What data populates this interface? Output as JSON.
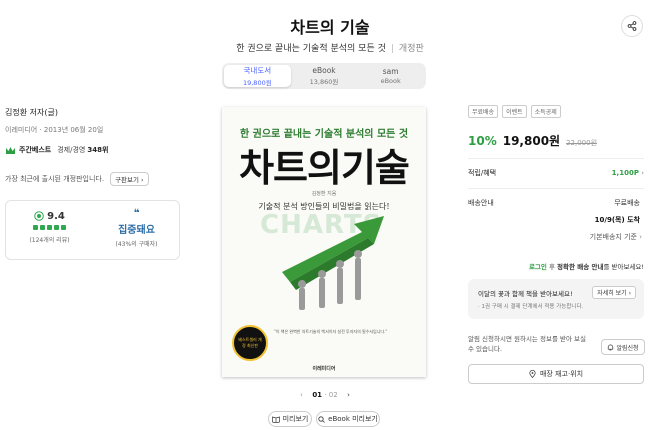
{
  "header": {
    "title": "차트의 기술",
    "subtitle": "한 권으로 끝내는 기술적 분석의 모든 것",
    "edition": "개정판",
    "share_icon": "share-icon"
  },
  "format_tabs": [
    {
      "label": "국내도서",
      "price": "19,800원",
      "active": true
    },
    {
      "label": "eBook",
      "price": "13,860원",
      "active": false
    },
    {
      "label": "sam",
      "price": "eBook",
      "active": false
    }
  ],
  "book": {
    "author": "김정환 저자(글)",
    "publisher_date": "이레미디어 · 2013년 06월 20일",
    "bestseller": {
      "name": "주간베스트",
      "category": "경제/경영",
      "rank": "348위"
    },
    "description": "가장 최근에 출시된 개정판입니다.",
    "buy_button": "구판보기"
  },
  "stats": {
    "rating": "9.4",
    "rating_count": "(124개의 리뷰)",
    "review_tag": "집중돼요",
    "review_ratio": "(43%의 구매자)"
  },
  "cover": {
    "top_line": "한 권으로 끝내는 기술적 분석의 모든 것",
    "title": "차트의기술",
    "author": "김정환 지음",
    "subtitle": "기술적 분석 방인들의 비밀법을 읽는다!",
    "watermark": "CHARTS",
    "badge": "베스트셀러 개정 최신판",
    "quote": "\"이 책은 완벽한 차트기술의 백서이자 실전 투자자의 필수서입니다.\"",
    "publisher": "이레미디어"
  },
  "pager": {
    "current": "01",
    "total": "02"
  },
  "preview_buttons": {
    "preview": "미리보기",
    "ebook_preview": "eBook 미리보기"
  },
  "purchase": {
    "badges": [
      "무료배송",
      "이벤트",
      "소득공제"
    ],
    "discount": "10%",
    "price": "19,800원",
    "original_price": "22,000원",
    "points_label": "적립/혜택",
    "points_value": "1,100P",
    "shipping_label": "배송안내",
    "shipping_fee": "무료배송",
    "delivery_date": "10/9(목) 도착",
    "delivery_note": "기본배송지 기준",
    "login_link": "로그인",
    "login_text_1": "후",
    "login_text_bold": "정확한 배송 안내",
    "login_text_2": "를 받아보세요!",
    "bouquet_title": "이달의 꽃과 함께 책을 받아보세요!",
    "bouquet_note": "· 1권 구매 시 결제 단계에서 적용 가능합니다.",
    "bouquet_button": "자세히 보기",
    "alarm_text": "알림 신청하시면 원하시는 정보를 받아 보실 수 있습니다.",
    "alarm_button": "알림신청",
    "stock_button": "매장 재고·위치"
  },
  "colors": {
    "accent_green": "#2e9e44",
    "tab_blue": "#4a62ff"
  }
}
